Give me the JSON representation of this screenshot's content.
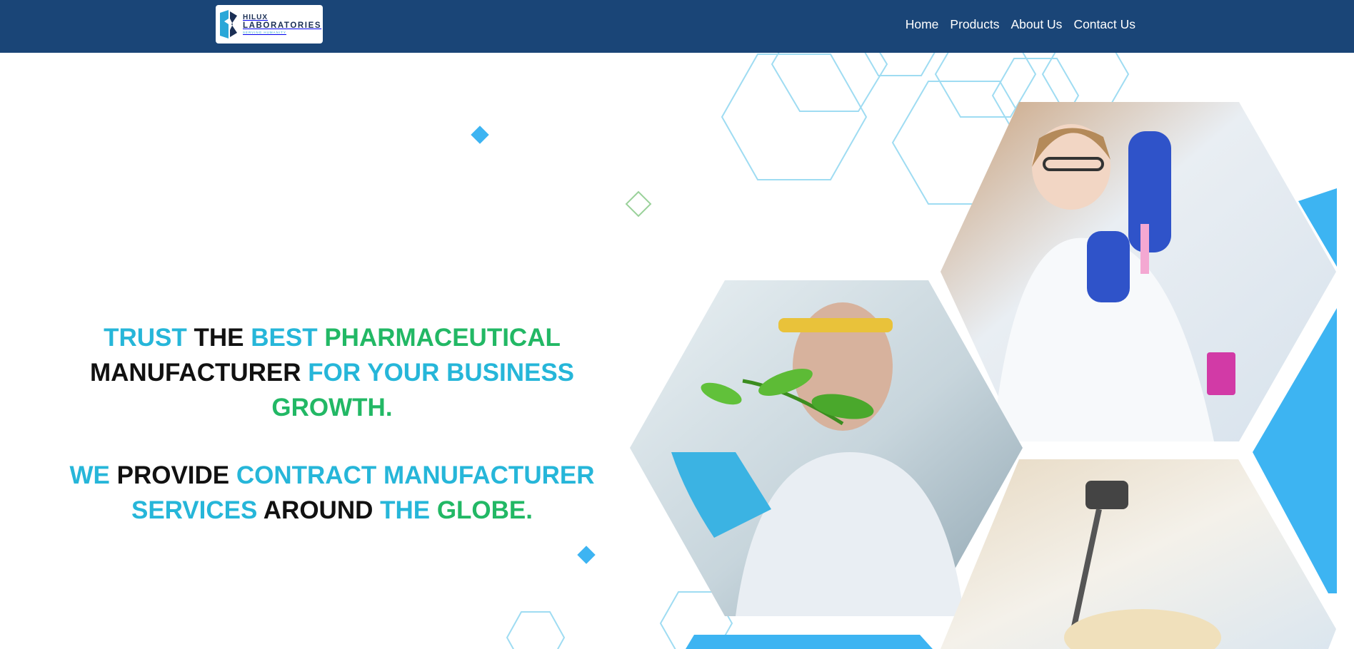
{
  "brand": {
    "name_line1": "HILUX",
    "name_line2": "LABORATORIES",
    "tagline": "SERVING HUMANITY"
  },
  "nav": {
    "items": [
      "Home",
      "Products",
      "About Us",
      "Contact Us"
    ]
  },
  "hero": {
    "headline1": [
      {
        "text": "TRUST ",
        "color": "cyan"
      },
      {
        "text": "THE ",
        "color": "black"
      },
      {
        "text": "BEST ",
        "color": "cyan"
      },
      {
        "text": "PHARMACEUTICAL",
        "color": "green"
      },
      {
        "text": "MANUFACTURER ",
        "color": "black"
      },
      {
        "text": "FOR YOUR ",
        "color": "cyan"
      },
      {
        "text": "BUSINESS ",
        "color": "cyan"
      },
      {
        "text": "GROWTH.",
        "color": "green"
      }
    ],
    "headline2": [
      {
        "text": "WE ",
        "color": "cyan"
      },
      {
        "text": "PROVIDE ",
        "color": "black"
      },
      {
        "text": "CONTRACT ",
        "color": "cyan"
      },
      {
        "text": "MANUFACTURER",
        "color": "cyan"
      },
      {
        "text": "SERVICES ",
        "color": "cyan"
      },
      {
        "text": "AROUND ",
        "color": "black"
      },
      {
        "text": "THE ",
        "color": "cyan"
      },
      {
        "text": "GLOBE.",
        "color": "green"
      }
    ]
  },
  "colors": {
    "navbar": "#1a4577",
    "cyan": "#26b6d9",
    "green": "#22b865",
    "black": "#111111",
    "accent_blue": "#3db4f2",
    "hex_outline": "#9fdcf2"
  },
  "icons": [
    "brand-logo-icon",
    "diamond-icon",
    "hexagon-icon"
  ]
}
